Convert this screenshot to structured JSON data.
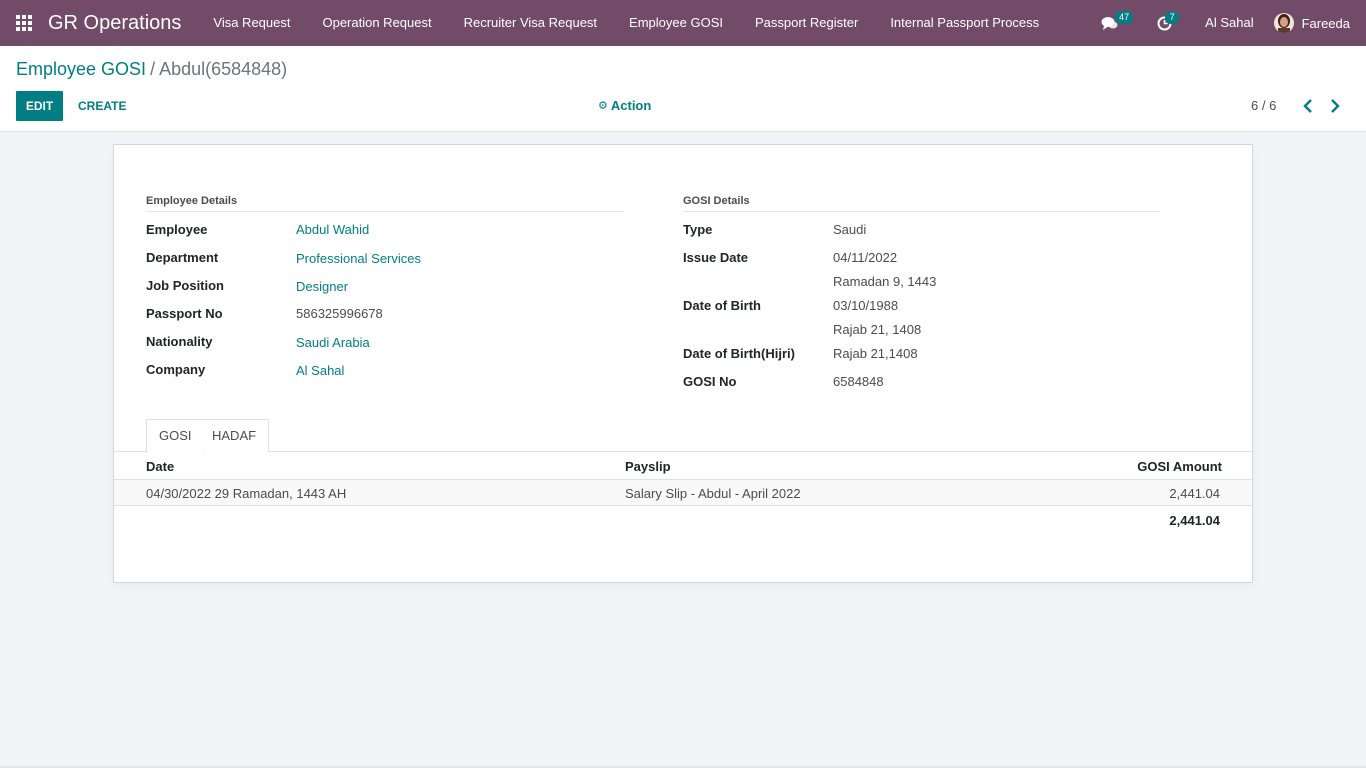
{
  "navbar": {
    "brand": "GR Operations",
    "menu": [
      {
        "label": "Visa Request"
      },
      {
        "label": "Operation Request"
      },
      {
        "label": "Recruiter Visa Request"
      },
      {
        "label": "Employee GOSI"
      },
      {
        "label": "Passport Register"
      },
      {
        "label": "Internal Passport Process"
      }
    ],
    "messages_count": "47",
    "activities_count": "7",
    "company": "Al Sahal",
    "user": "Fareeda",
    "bg_color": "#714b67",
    "badge_color": "#017e84"
  },
  "breadcrumb": {
    "parent": "Employee GOSI",
    "separator": "/",
    "current": "Abdul(6584848)"
  },
  "controls": {
    "edit_label": "EDIT",
    "create_label": "CREATE",
    "action_label": "Action",
    "pager": "6 / 6"
  },
  "employee_details": {
    "title": "Employee Details",
    "fields": [
      {
        "label": "Employee",
        "value": "Abdul Wahid"
      },
      {
        "label": "Department",
        "value": "Professional Services"
      },
      {
        "label": "Job Position",
        "value": "Designer"
      },
      {
        "label": "Passport No",
        "value": "586325996678"
      },
      {
        "label": "Nationality",
        "value": "Saudi Arabia"
      },
      {
        "label": "Company",
        "value": "Al Sahal"
      }
    ]
  },
  "gosi_details": {
    "title": "GOSI Details",
    "type_label": "Type",
    "type_value": "Saudi",
    "issue_date_label": "Issue Date",
    "issue_date_value": "04/11/2022",
    "issue_date_hijri": "Ramadan 9, 1443",
    "dob_label": "Date of Birth",
    "dob_value": "03/10/1988",
    "dob_hijri": "Rajab 21, 1408",
    "dob_hijri_label": "Date of Birth(Hijri)",
    "dob_hijri_value": "Rajab 21,1408",
    "gosi_no_label": "GOSI No",
    "gosi_no_value": "6584848"
  },
  "tabs": [
    {
      "label": "GOSI",
      "active": true
    },
    {
      "label": "HADAF",
      "active": false
    }
  ],
  "table": {
    "columns": [
      "Date",
      "Payslip",
      "GOSI Amount"
    ],
    "rows": [
      {
        "date": "04/30/2022 29 Ramadan, 1443 AH",
        "payslip": "Salary Slip - Abdul - April 2022",
        "amount": "2,441.04"
      }
    ],
    "total": "2,441.04"
  },
  "colors": {
    "primary": "#017e84",
    "text": "#4c4c4c"
  }
}
